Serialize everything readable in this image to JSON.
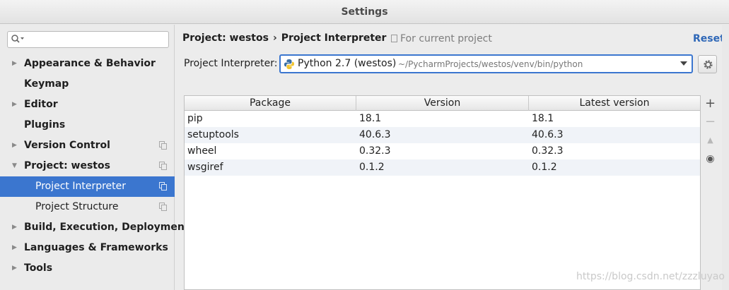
{
  "window": {
    "title": "Settings"
  },
  "search": {
    "placeholder": "",
    "value": "",
    "icon": "search-icon"
  },
  "sidebar": {
    "items": [
      {
        "label": "Appearance & Behavior",
        "expandable": true,
        "bold": true
      },
      {
        "label": "Keymap",
        "expandable": false,
        "bold": true
      },
      {
        "label": "Editor",
        "expandable": true,
        "bold": true
      },
      {
        "label": "Plugins",
        "expandable": false,
        "bold": true
      },
      {
        "label": "Version Control",
        "expandable": true,
        "bold": true,
        "project_scope": true
      },
      {
        "label": "Project: westos",
        "expandable": true,
        "expanded": true,
        "bold": true,
        "project_scope": true
      },
      {
        "label": "Project Interpreter",
        "sub": true,
        "selected": true,
        "project_scope": true
      },
      {
        "label": "Project Structure",
        "sub": true,
        "project_scope": true
      },
      {
        "label": "Build, Execution, Deployment",
        "expandable": true,
        "bold": true
      },
      {
        "label": "Languages & Frameworks",
        "expandable": true,
        "bold": true
      },
      {
        "label": "Tools",
        "expandable": true,
        "bold": true
      }
    ]
  },
  "header": {
    "breadcrumb": [
      "Project: westos",
      "Project Interpreter"
    ],
    "separator": "›",
    "scope_label": "For current project",
    "reset_label": "Reset"
  },
  "interpreter": {
    "label": "Project Interpreter:",
    "name": "Python 2.7 (westos)",
    "path": "~/PycharmProjects/westos/venv/bin/python"
  },
  "packages": {
    "columns": [
      "Package",
      "Version",
      "Latest version"
    ],
    "rows": [
      {
        "package": "pip",
        "version": "18.1",
        "latest": "18.1"
      },
      {
        "package": "setuptools",
        "version": "40.6.3",
        "latest": "40.6.3"
      },
      {
        "package": "wheel",
        "version": "0.32.3",
        "latest": "0.32.3"
      },
      {
        "package": "wsgiref",
        "version": "0.1.2",
        "latest": "0.1.2"
      }
    ]
  },
  "tools": [
    {
      "symbol": "+",
      "icon": "add-icon",
      "enabled": true
    },
    {
      "symbol": "−",
      "icon": "remove-icon",
      "enabled": false
    },
    {
      "symbol": "▲",
      "icon": "upgrade-icon",
      "enabled": false
    },
    {
      "symbol": "◉",
      "icon": "eye-icon",
      "enabled": true
    }
  ],
  "watermark": "https://blog.csdn.net/zzzluyao",
  "colors": {
    "selection": "#3b76cf",
    "link": "#2e67b7"
  }
}
